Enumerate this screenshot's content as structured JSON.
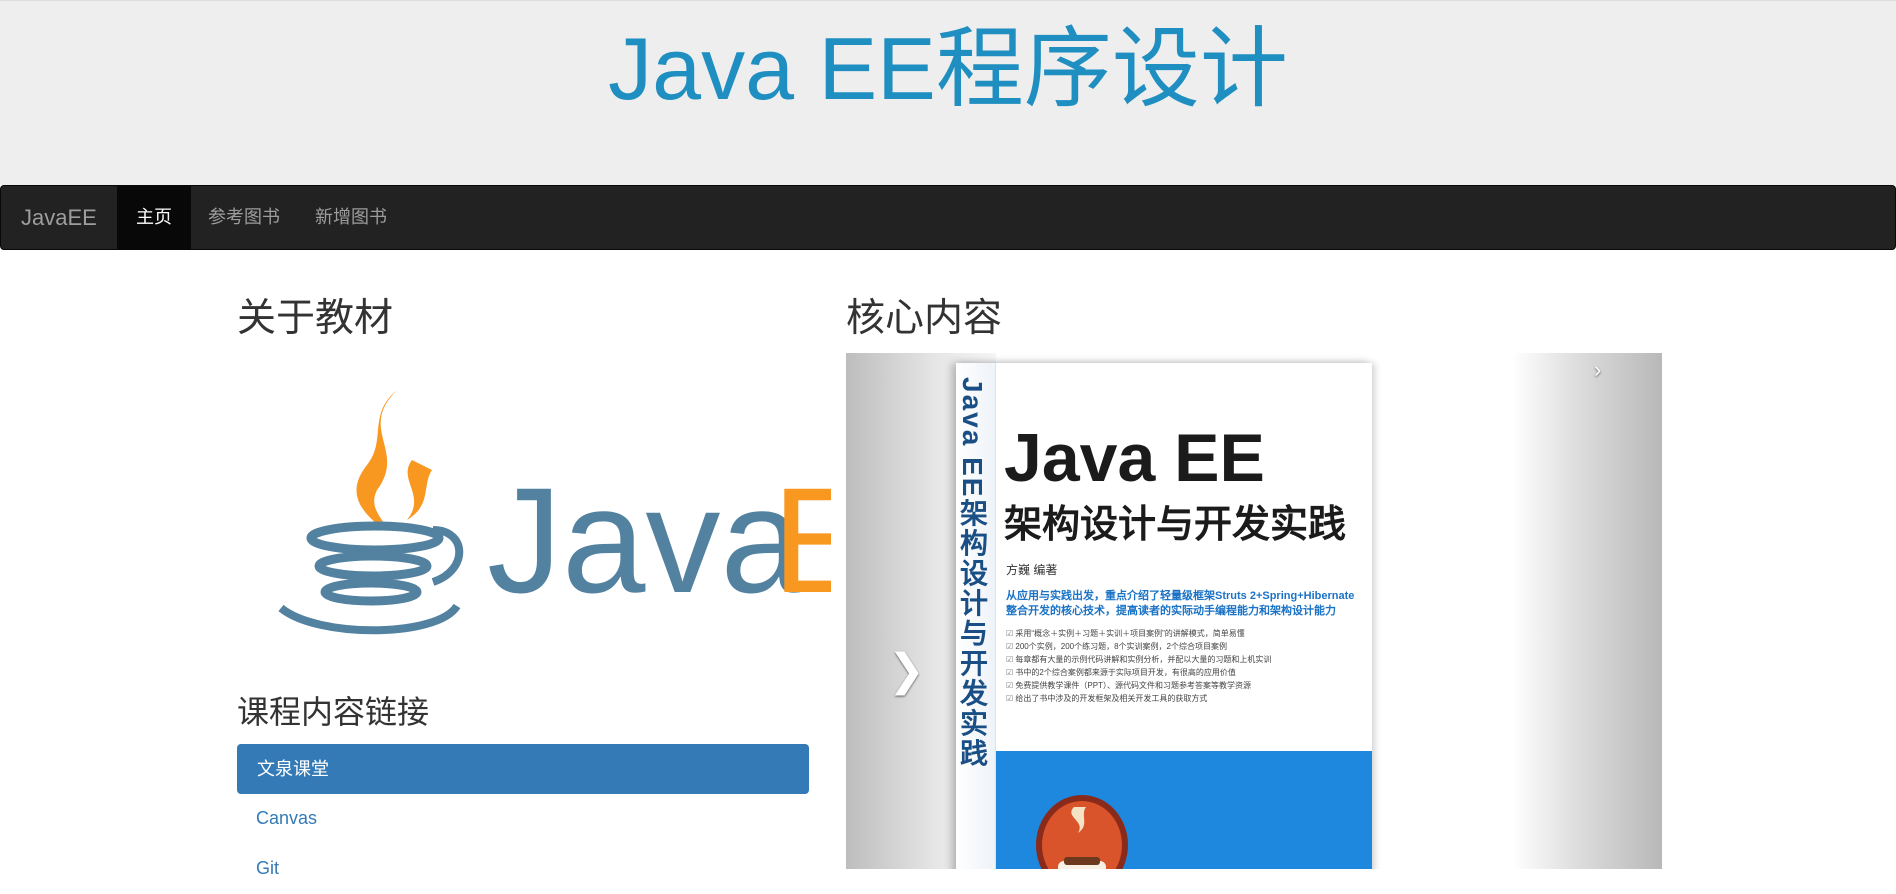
{
  "header": {
    "title": "Java EE程序设计"
  },
  "navbar": {
    "brand": "JavaEE",
    "items": [
      {
        "label": "主页",
        "active": true
      },
      {
        "label": "参考图书",
        "active": false
      },
      {
        "label": "新增图书",
        "active": false
      }
    ]
  },
  "about": {
    "heading": "关于教材",
    "logo_text": "Java",
    "logo_text_partial": "E"
  },
  "links": {
    "heading": "课程内容链接",
    "items": [
      {
        "label": "文泉课堂",
        "active": true
      },
      {
        "label": "Canvas",
        "active": false
      },
      {
        "label": "Git",
        "active": false
      }
    ]
  },
  "core": {
    "heading": "核心内容",
    "book": {
      "spine": "Java EE架构设计与开发实践",
      "title": "Java EE",
      "subtitle": "架构设计与开发实践",
      "author": "方巍  编著",
      "summary": "从应用与实践出发，重点介绍了轻量级框架Struts 2+Spring+Hibernate整合开发的核心技术，提高读者的实际动手编程能力和架构设计能力",
      "bullets": [
        "采用“概念＋实例＋习题＋实训＋项目案例”的讲解模式，简单易懂",
        "200个实例，200个练习题，8个实训案例，2个综合项目案例",
        "每章都有大量的示例代码讲解和实例分析，并配以大量的习题和上机实训",
        "书中的2个综合案例都来源于实际项目开发，有很高的应用价值",
        "免费提供教学课件（PPT）、源代码文件和习题参考答案等教学资源",
        "给出了书中涉及的开发框架及相关开发工具的获取方式"
      ]
    },
    "controls": {
      "prev": "❯",
      "next": "›"
    }
  },
  "colors": {
    "title": "#1f8ec0",
    "navbar": "#222222",
    "link": "#337ab7",
    "java_blue": "#5382a1",
    "java_orange": "#f89820"
  }
}
